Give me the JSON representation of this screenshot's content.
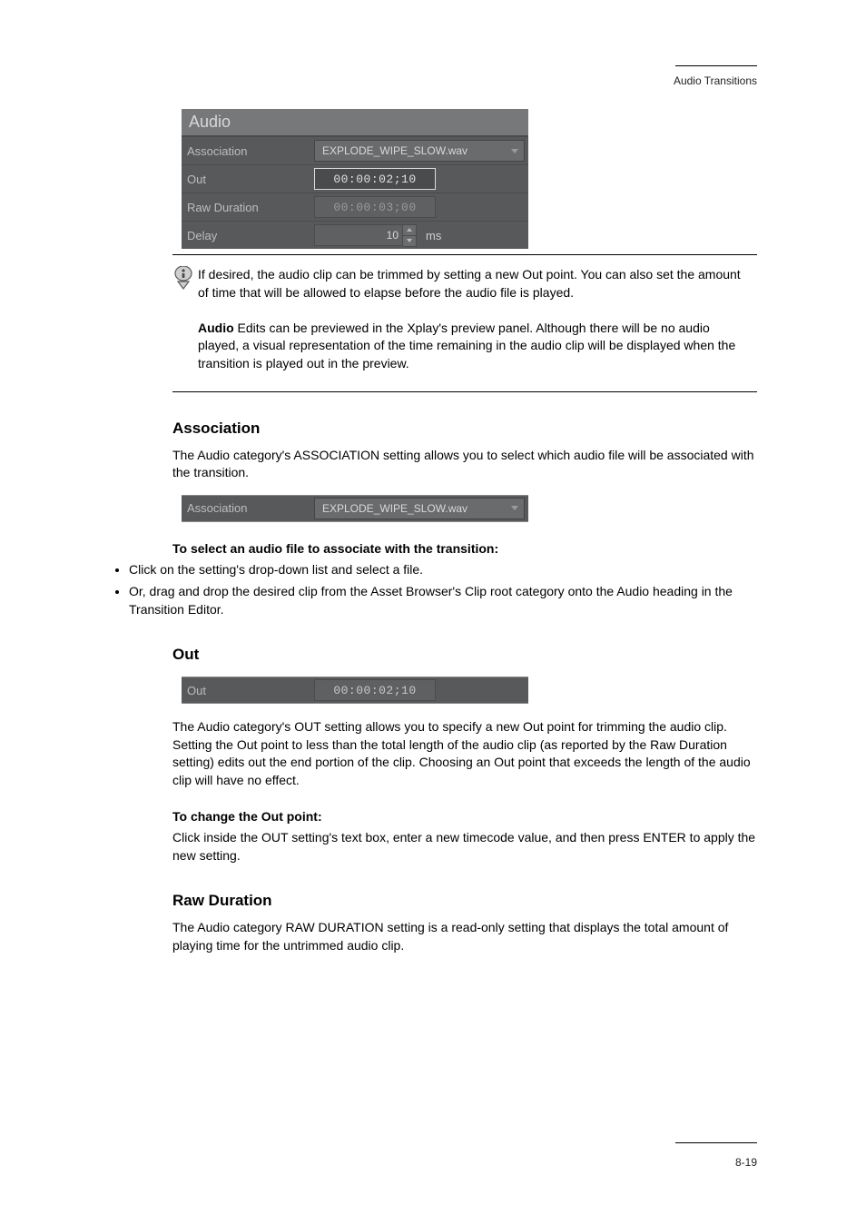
{
  "header_right": "Audio Transitions",
  "page_number": "8-19",
  "panel": {
    "header": "Audio",
    "rows": {
      "association_label": "Association",
      "association_value": "EXPLODE_WIPE_SLOW.wav",
      "out_label": "Out",
      "out_value": "00:00:02;10",
      "raw_label": "Raw Duration",
      "raw_value": "00:00:03;00",
      "delay_label": "Delay",
      "delay_value": "10",
      "delay_unit": "ms"
    }
  },
  "note": {
    "bold_span": "Audio",
    "body": "Edits can be previewed in the Xplay's preview panel. Although there will be no audio played, a visual representation of the time remaining in the audio clip will be displayed when the transition is played out in the preview.",
    "body_prefix": "If desired, the audio clip can be trimmed by setting a new Out point. You can also set the amount of time that will be allowed to elapse before the audio file is played."
  },
  "sections": {
    "association": {
      "heading": "Association",
      "body": "The Audio category's ASSOCIATION setting allows you to select which audio file will be associated with the transition.",
      "strip_label": "Association",
      "strip_value": "EXPLODE_WIPE_SLOW.wav",
      "below_heading": "To select an audio file to associate with the transition:",
      "bullets": [
        "Click on the setting's drop-down list and select a file.",
        "Or, drag and drop the desired clip from the Asset Browser's Clip root category onto the Audio heading in the Transition Editor."
      ]
    },
    "out": {
      "heading": "Out",
      "strip_label": "Out",
      "strip_value": "00:00:02;10",
      "body": "The Audio category's OUT setting allows you to specify a new Out point for trimming the audio clip. Setting the Out point to less than the total length of the audio clip (as reported by the Raw Duration setting) edits out the end portion of the clip. Choosing an Out point that exceeds the length of the audio clip will have no effect.",
      "body2_heading": "To change the Out point:",
      "body2": "Click inside the OUT setting's text box, enter a new timecode value, and then press ENTER to apply the new setting."
    },
    "raw": {
      "heading": "Raw Duration",
      "body": "The Audio category RAW DURATION setting is a read-only setting that displays the total amount of playing time for the untrimmed audio clip."
    }
  }
}
